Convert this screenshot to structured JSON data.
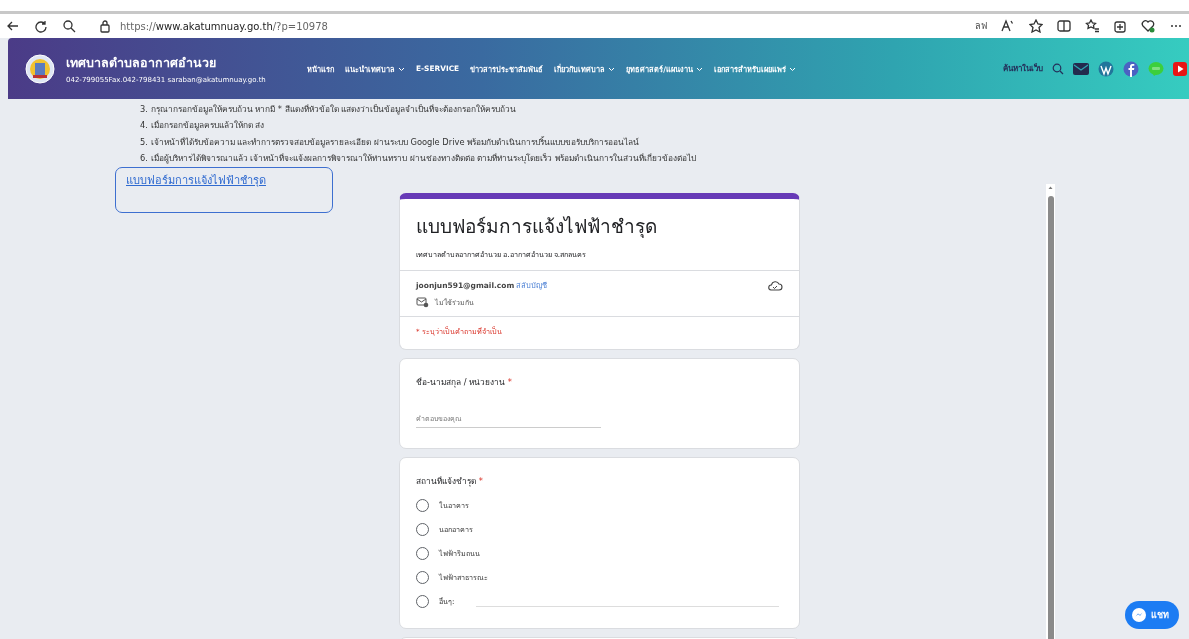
{
  "browser": {
    "url_prefix": "https://",
    "url_host": "www.akatumnuay.go.th",
    "url_path": "/?p=10978",
    "toolbar_text": "ลฟ"
  },
  "site": {
    "name": "เทศบาลตำบลอากาศอำนวย",
    "contact": "042-799055Fax.042-798431 saraban@akatumnuay.go.th",
    "nav": [
      {
        "label": "หน้าแรก",
        "dropdown": false
      },
      {
        "label": "แนะนำเทศบาล",
        "dropdown": true
      },
      {
        "label": "E-SERVICE",
        "dropdown": false
      },
      {
        "label": "ข่าวสารประชาสัมพันธ์",
        "dropdown": false
      },
      {
        "label": "เกี่ยวกับเทศบาล",
        "dropdown": true
      },
      {
        "label": "ยุทธศาสตร์/แผนงาน",
        "dropdown": true
      },
      {
        "label": "เอกสารสำหรับเผยแพร่",
        "dropdown": true
      }
    ],
    "search_label": "ค้นหาในเว็บ"
  },
  "instructions": [
    "3. กรุณากรอกข้อมูลให้ครบถ้วน หากมี * สีแดงที่หัวข้อใด แสดงว่าเป็นข้อมูลจำเป็นที่จะต้องกรอกให้ครบถ้วน",
    "4. เมื่อกรอกข้อมูลครบแล้วให้กด ส่ง",
    "5. เจ้าหน้าที่ได้รับข้อความ และทำการตรวจสอบข้อมูลรายละเอียด ผ่านระบบ Google Drive พร้อมกับดำเนินการปริ้นแบบขอรับบริการออนไลน์",
    "6. เมื่อผู้บริหารได้พิจารณาแล้ว เจ้าหน้าที่จะแจ้งผลการพิจารณาให้ท่านทราบ ผ่านช่องทางติดต่อ ตามที่ท่านระบุโดยเร็ว พร้อมดำเนินการในส่วนที่เกี่ยวข้องต่อไป"
  ],
  "form_link": "แบบฟอร์มการแจ้งไฟฟ้าชำรุด",
  "form": {
    "title": "แบบฟอร์มการแจ้งไฟฟ้าชำรุด",
    "description": "เทศบาลตำบลอากาศอำนวย อ.อากาศอำนวย จ.สกลนคร",
    "email": "joonjun591@gmail.com",
    "switch_account": "สลับบัญชี",
    "not_shared": "ไม่ใช้ร่วมกัน",
    "required_note": "* ระบุว่าเป็นคำถามที่จำเป็น",
    "questions": [
      {
        "kind": "text",
        "label": "ชื่อ-นามสกุล / หน่วยงาน",
        "required_mark": "*",
        "placeholder": "คำตอบของคุณ"
      },
      {
        "kind": "radio",
        "label": "สถานที่แจ้งชำรุด",
        "required_mark": "*",
        "options": [
          {
            "label": "ในอาคาร",
            "selected": false
          },
          {
            "label": "นอกอาคาร",
            "selected": false
          },
          {
            "label": "ไฟฟ้าริมถนน",
            "selected": false
          },
          {
            "label": "ไฟฟ้าสาธารณะ",
            "selected": false
          },
          {
            "label": "อื่นๆ:",
            "selected": false,
            "other": true
          }
        ]
      }
    ]
  },
  "chat_button": "แชท"
}
